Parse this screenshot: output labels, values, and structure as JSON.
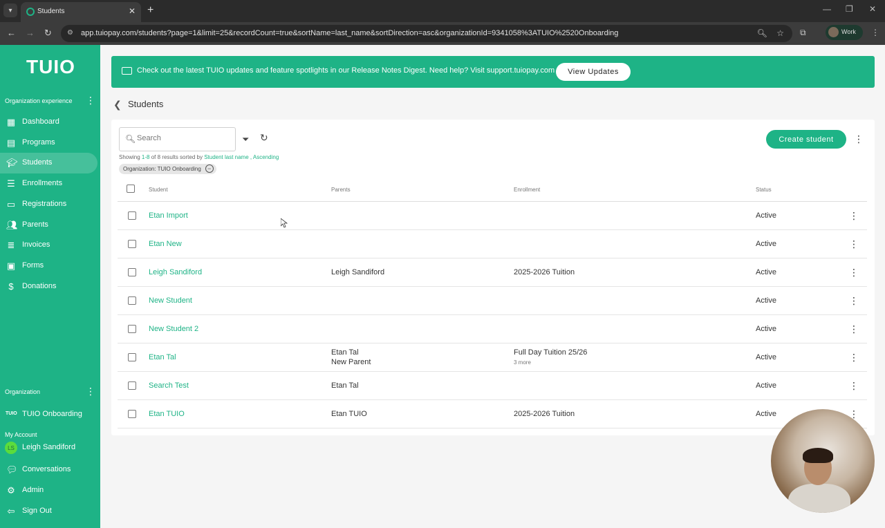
{
  "browser": {
    "tab_title": "Students",
    "url": "app.tuiopay.com/students?page=1&limit=25&recordCount=true&sortName=last_name&sortDirection=asc&organizationId=9341058%3ATUIO%2520Onboarding",
    "profile_label": "Work"
  },
  "sidebar": {
    "logo": "TUIO",
    "section_org_experience": "Organization experience",
    "items": [
      {
        "label": "Dashboard",
        "icon": "dashboard-icon"
      },
      {
        "label": "Programs",
        "icon": "programs-icon"
      },
      {
        "label": "Students",
        "icon": "students-icon"
      },
      {
        "label": "Enrollments",
        "icon": "enrollments-icon"
      },
      {
        "label": "Registrations",
        "icon": "registrations-icon"
      },
      {
        "label": "Parents",
        "icon": "parents-icon"
      },
      {
        "label": "Invoices",
        "icon": "invoices-icon"
      },
      {
        "label": "Forms",
        "icon": "forms-icon"
      },
      {
        "label": "Donations",
        "icon": "dollar-icon"
      }
    ],
    "active_item": "Students",
    "section_organization": "Organization",
    "org_logo": "TUIO",
    "org_name": "TUIO Onboarding",
    "section_my_account": "My Account",
    "user_initials": "LS",
    "user_name": "Leigh Sandiford",
    "conversations": "Conversations",
    "admin": "Admin",
    "sign_out": "Sign Out"
  },
  "banner": {
    "text": "Check out the latest TUIO updates and feature spotlights in our Release Notes Digest. Need help? Visit support.tuiopay.com",
    "button": "View Updates"
  },
  "page": {
    "title": "Students"
  },
  "toolbar": {
    "search_placeholder": "Search",
    "create_button": "Create student"
  },
  "results": {
    "prefix": "Showing ",
    "range": "1-8",
    "middle": " of 8 results sorted by ",
    "sort_field": "Student last name",
    "sep": " , ",
    "sort_dir": "Ascending"
  },
  "filter_chip": "Organization: TUIO Onboarding",
  "table": {
    "headers": {
      "student": "Student",
      "parents": "Parents",
      "enrollment": "Enrollment",
      "status": "Status"
    },
    "rows": [
      {
        "student": "Etan Import",
        "parents": "",
        "parents2": "",
        "enrollment": "",
        "more": "",
        "status": "Active"
      },
      {
        "student": "Etan New",
        "parents": "",
        "parents2": "",
        "enrollment": "",
        "more": "",
        "status": "Active"
      },
      {
        "student": "Leigh Sandiford",
        "parents": "Leigh Sandiford",
        "parents2": "",
        "enrollment": "2025-2026 Tuition",
        "more": "",
        "status": "Active"
      },
      {
        "student": "New Student",
        "parents": "",
        "parents2": "",
        "enrollment": "",
        "more": "",
        "status": "Active"
      },
      {
        "student": "New Student 2",
        "parents": "",
        "parents2": "",
        "enrollment": "",
        "more": "",
        "status": "Active"
      },
      {
        "student": "Etan Tal",
        "parents": "Etan Tal",
        "parents2": "New Parent",
        "enrollment": "Full Day Tuition 25/26",
        "more": "3 more",
        "status": "Active"
      },
      {
        "student": "Search Test",
        "parents": "Etan Tal",
        "parents2": "",
        "enrollment": "",
        "more": "",
        "status": "Active"
      },
      {
        "student": "Etan TUIO",
        "parents": "Etan TUIO",
        "parents2": "",
        "enrollment": "2025-2026 Tuition",
        "more": "",
        "status": "Active"
      }
    ]
  },
  "colors": {
    "brand": "#1eb386",
    "sidebar_bg": "#1eb386"
  }
}
